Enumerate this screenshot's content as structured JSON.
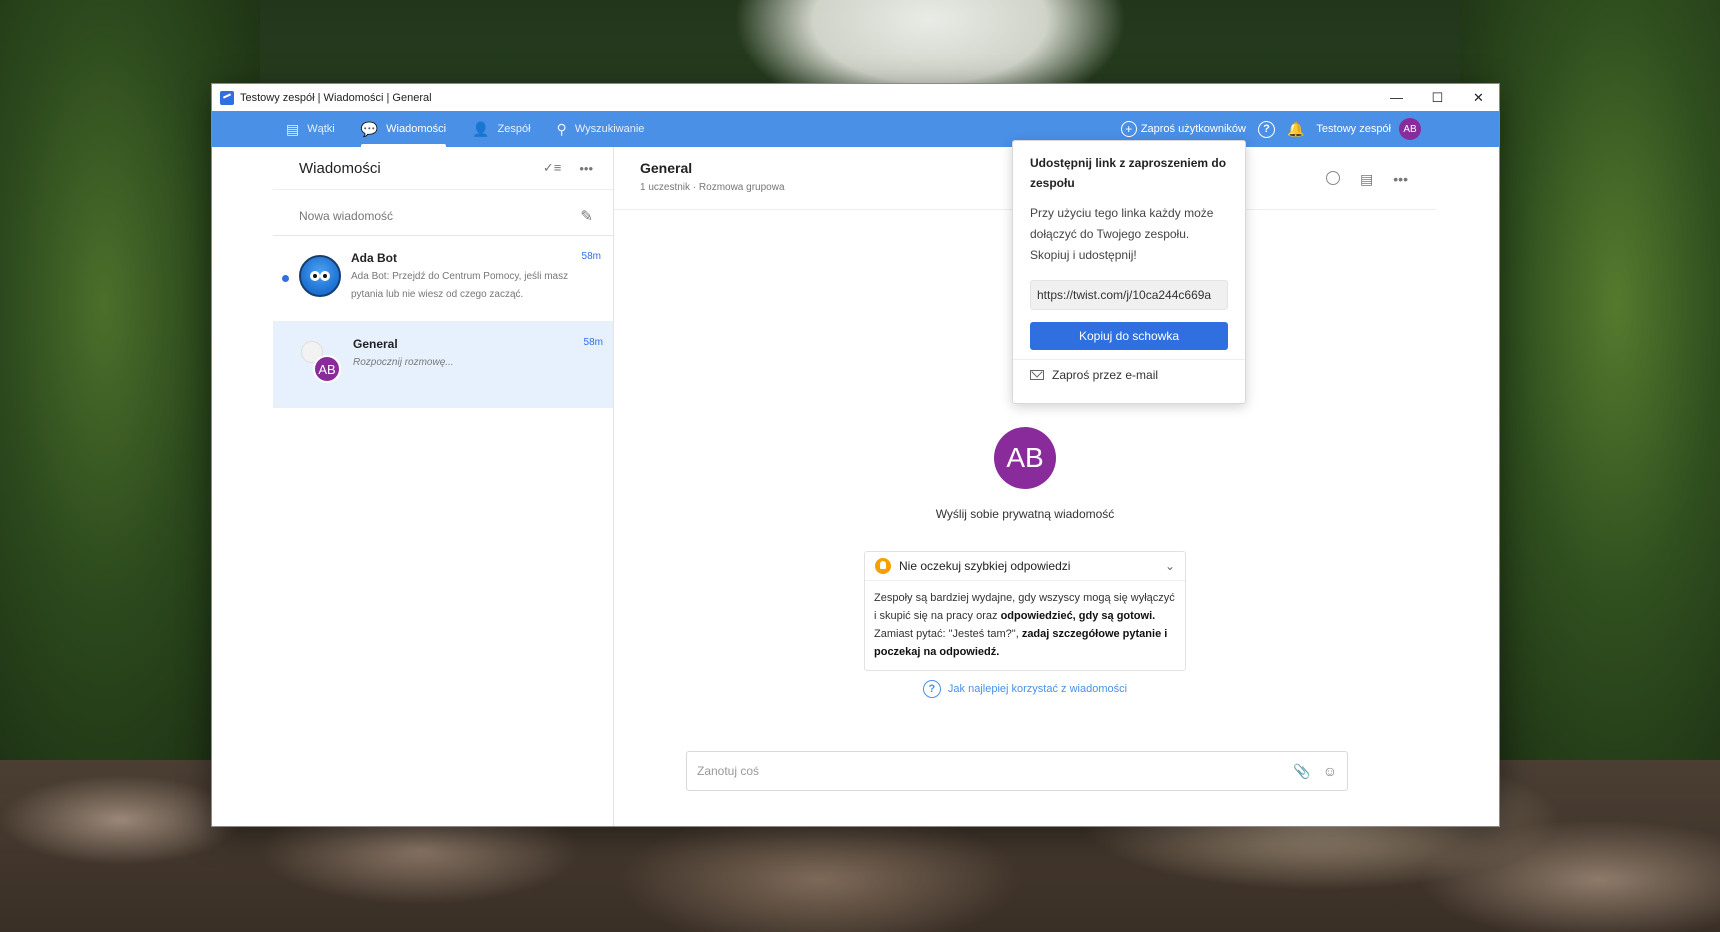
{
  "window": {
    "title": "Testowy zespół | Wiadomości | General",
    "controls": {
      "minimize": "—",
      "maximize": "☐",
      "close": "✕"
    }
  },
  "nav": {
    "tabs": [
      {
        "label": "Wątki",
        "icon": "threads-icon"
      },
      {
        "label": "Wiadomości",
        "icon": "messages-icon",
        "active": true
      },
      {
        "label": "Zespół",
        "icon": "team-icon"
      },
      {
        "label": "Wyszukiwanie",
        "icon": "search-icon"
      }
    ],
    "invite_label": "Zaproś użytkowników",
    "team_name": "Testowy zespół",
    "avatar_initials": "AB"
  },
  "sidebar": {
    "title": "Wiadomości",
    "new_message_label": "Nowa wiadomość",
    "threads": [
      {
        "name": "Ada Bot",
        "time": "58m",
        "preview": "Ada Bot: Przejdź do Centrum Pomocy, jeśli masz pytania lub nie wiesz od czego zacząć.",
        "unread": true
      },
      {
        "name": "General",
        "time": "58m",
        "preview": "Rozpocznij rozmowę...",
        "avatar_initials": "AB",
        "selected": true
      }
    ]
  },
  "main": {
    "title": "General",
    "subtitle": "1 uczestnik · Rozmowa grupowa",
    "avatar_initials": "AB",
    "intro_text": "Wyślij sobie prywatną wiadomość",
    "tip": {
      "title": "Nie oczekuj szybkiej odpowiedzi",
      "p1_a": "Zespoły są bardziej wydajne, gdy wszyscy mogą się wyłączyć i skupić się na pracy oraz ",
      "p1_b": "odpowiedzieć, gdy są gotowi.",
      "p2_a": "Zamiast pytać: \"Jesteś tam?\", ",
      "p2_b": "zadaj szczegółowe pytanie i poczekaj na odpowiedź."
    },
    "help_link": "Jak najlepiej korzystać z wiadomości",
    "composer_placeholder": "Zanotuj coś"
  },
  "popover": {
    "title": "Udostępnij link z zaproszeniem do zespołu",
    "text": "Przy użyciu tego linka każdy może dołączyć do Twojego zespołu. Skopiuj i udostępnij!",
    "link": "https://twist.com/j/10ca244c669a",
    "copy_button": "Kopiuj do schowka",
    "email_label": "Zaproś przez e-mail"
  },
  "colors": {
    "accent": "#4a90e6",
    "button": "#2f6fe0",
    "avatar": "#8a2b9c",
    "tip": "#f5a000"
  }
}
